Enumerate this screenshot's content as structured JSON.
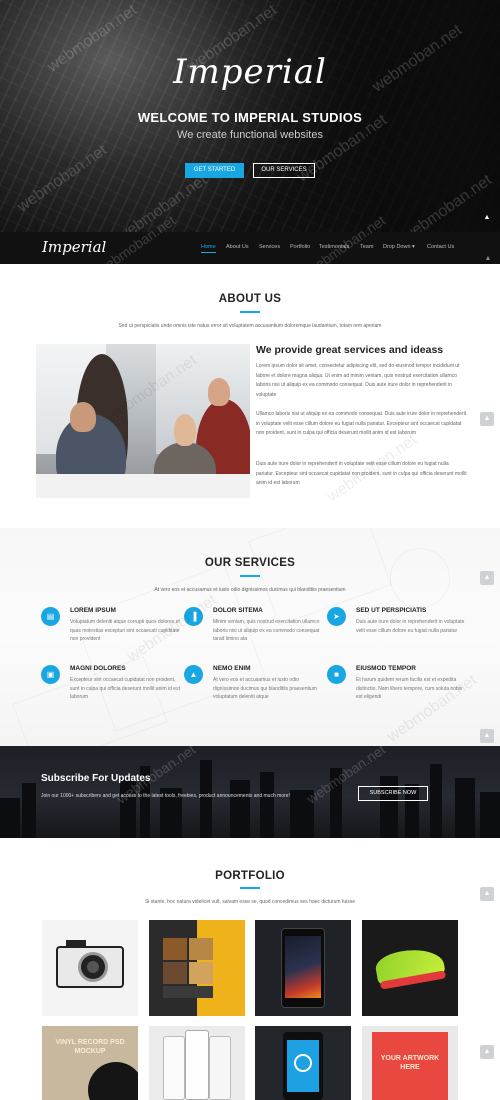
{
  "hero": {
    "logo": "Imperial",
    "title": "WELCOME TO IMPERIAL STUDIOS",
    "subtitle": "We create functional websites",
    "btn_primary": "GET STARTED",
    "btn_secondary": "OUR SERVICES"
  },
  "watermark": "webmoban.net",
  "navbar": {
    "logo": "Imperial",
    "items": [
      "Home",
      "About Us",
      "Services",
      "Portfolio",
      "Testimonials",
      "Team",
      "Drop Down ▾",
      "Contact Us"
    ],
    "active": "Home"
  },
  "about": {
    "title": "ABOUT US",
    "desc": "Sed ut perspiciatis unde omnis iste natus error sit voluptatem accusantium doloremque laudantium, totam rem aperiam",
    "heading": "We provide great services and ideass",
    "p1": "Lorem ipsum dolor sit amet, consectetur adipiscing elit, sed do eiusmod tempor incididunt ut labore et dolore magna aliqua. Ut enim ad minim veniam, quis nostrud exercitation ullamco laboris nisi ut aliquip ex ea commodo consequat. Duis aute irure dolor in reprehenderit in voluptate",
    "p2": "Ullamco laboris nisi ut aliquip ex ea commodo consequat. Duis aute irure dolor in reprehenderit in voluptate velit esse cillum dolore eu fugiat nulla pariatur. Excepteur sint occaecat cupidatat non proident, sunt in culpa qui officia deserunt mollit anim id est laborum",
    "p3": "Duis aute irure dolor in reprehenderit in voluptate velit esse cillum dolore eu fugiat nulla pariatur. Excepteur sint occaecat cupidatat non proident, sunt in culpa qui officia deserunt mollit anim id est laborum"
  },
  "services": {
    "title": "OUR SERVICES",
    "desc": "At vero eos et accusamus et iusto odio dignissimos ducimus qui blanditiis praesentium",
    "items": [
      {
        "icon": "briefcase-icon",
        "glyph": "▤",
        "title": "LOREM IPSUM",
        "text": "Voluptatum deleniti atque corrupti quos dolores et quas molestias excepturi sint occaecati cupiditate non provident"
      },
      {
        "icon": "chart-icon",
        "glyph": "▐",
        "title": "DOLOR SITEMA",
        "text": "Minim veniam, quis nostrud exercitation ullamco laboris nisi ut aliquip ex ea commodo consequat tarad limino ata"
      },
      {
        "icon": "paper-plane-icon",
        "glyph": "➤",
        "title": "SED UT PERSPICIATIS",
        "text": "Duis aute irure dolor in reprehenderit in voluptate velit esse cillum dolore eu fugiat nulla pariatur"
      },
      {
        "icon": "image-icon",
        "glyph": "▣",
        "title": "MAGNI DOLORES",
        "text": "Excepteur sint occaecat cupidatat non proident, sunt in culpa qui officia deserunt mollit anim id est laborum"
      },
      {
        "icon": "road-icon",
        "glyph": "▲",
        "title": "NEMO ENIM",
        "text": "At vero eos et accusamus et iusto odio dignissimos ducimus qui blanditiis praesentium voluptatum deleniti atque"
      },
      {
        "icon": "shopping-bag-icon",
        "glyph": "■",
        "title": "EIUSMOD TEMPOR",
        "text": "Et harum quidem rerum facilis est et expedita distinctio. Nam libero tempore, cum soluta nobis est eligendi"
      }
    ]
  },
  "subscribe": {
    "title": "Subscribe For Updates",
    "text": "Join our 1000+ subscribers and get access to the latest tools, freebies, product announcements and much more!",
    "button": "SUBSCRIBE NOW"
  },
  "portfolio": {
    "title": "PORTFOLIO",
    "desc": "Si stante, hoc natura videlicet vult, salvam esse se, quod concedimus ses haec dicturum fuisse",
    "items": [
      {
        "name": "camera"
      },
      {
        "name": "gallery"
      },
      {
        "name": "tablet"
      },
      {
        "name": "sneaker"
      },
      {
        "name": "vinyl-record",
        "label": "VINYL RECORD PSD MOCKUP"
      },
      {
        "name": "phones"
      },
      {
        "name": "clock-phone"
      },
      {
        "name": "artwork",
        "label": "YOUR ARTWORK HERE"
      }
    ]
  },
  "colors": {
    "accent": "#18a7e3",
    "dark": "#111111"
  }
}
